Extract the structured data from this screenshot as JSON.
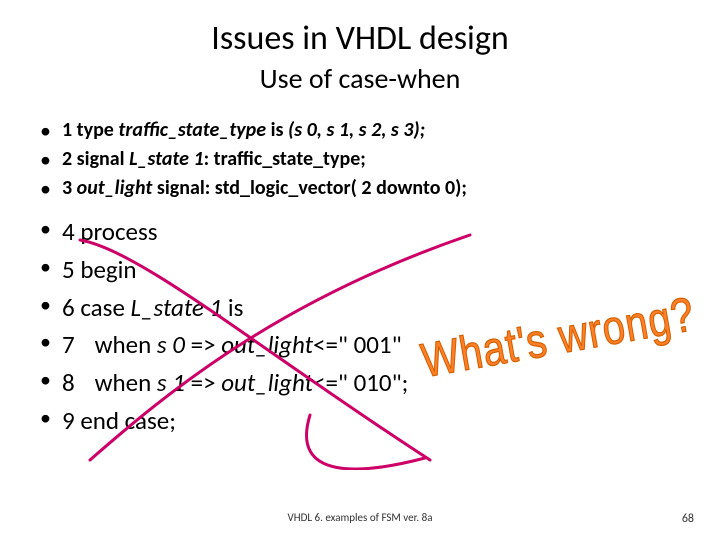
{
  "title": "Issues in VHDL design",
  "subtitle": "Use of case-when",
  "decl": {
    "l1_pre": "1 ",
    "l1_kw": "type ",
    "l1_id": "traffic_state_type",
    "l1_kw2": " is ",
    "l1_val": "(s 0, s 1, s 2, s 3);",
    "l2_pre": "2 ",
    "l2_kw": "signal ",
    "l2_id": "L_state 1",
    "l2_rest": ": traffic_state_type;",
    "l3_pre": "3 ",
    "l3_id": "out_light",
    "l3_rest": " signal: std_logic_vector( 2 downto 0);"
  },
  "proc": {
    "l4": "4  process",
    "l5": "5  begin",
    "l6_pre": "6  case ",
    "l6_id": "L_state 1",
    "l6_post": " is",
    "l7_pre": "7",
    "l7_when": "when ",
    "l7_s": "s 0",
    "l7_arrow": " => ",
    "l7_out": "out_light",
    "l7_assign": "<=\" 001\"",
    "l8_pre": "8",
    "l8_when": "when ",
    "l8_s": "s 1",
    "l8_arrow": " => ",
    "l8_out": "out_light",
    "l8_assign": "<=\" 010\";",
    "l9": "9 end case;"
  },
  "annotation": "What's wrong?",
  "footer": "VHDL 6. examples of FSM ver. 8a",
  "page": "68"
}
